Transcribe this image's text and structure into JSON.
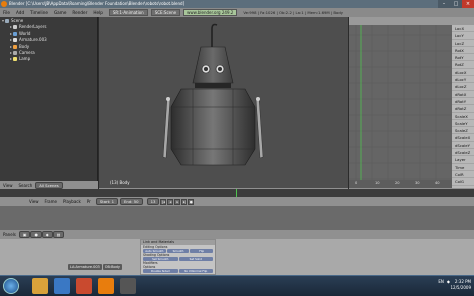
{
  "window": {
    "title": "Blender [C:\\Users\\JB\\AppData\\Roaming\\Blender Foundation\\Blender\\robots\\robot.blend]"
  },
  "menu": {
    "items": [
      "File",
      "Add",
      "Timeline",
      "Game",
      "Render",
      "Help"
    ],
    "screen": "SR:1-Animation",
    "scene": "SCE:Scene",
    "url": "www.blender.org 249.2",
    "stats": "Ve:998 | Fa:1026 | Ob:2-2 | La:1 | Mem:1.69M | Body"
  },
  "outliner": {
    "rows": [
      {
        "label": "Scene",
        "depth": 0,
        "expanded": true,
        "icon": "scene-icon"
      },
      {
        "label": "RenderLayers",
        "depth": 1,
        "expanded": false,
        "icon": "render-layers-icon"
      },
      {
        "label": "World",
        "depth": 1,
        "expanded": false,
        "icon": "world-icon"
      },
      {
        "label": "Armature.003",
        "depth": 1,
        "expanded": false,
        "icon": "armature-icon"
      },
      {
        "label": "Body",
        "depth": 1,
        "expanded": false,
        "icon": "mesh-icon"
      },
      {
        "label": "Camera",
        "depth": 1,
        "expanded": false,
        "icon": "camera-icon"
      },
      {
        "label": "Lamp",
        "depth": 1,
        "expanded": false,
        "icon": "lamp-icon"
      }
    ]
  },
  "outliner_toolbar": {
    "view": "View",
    "search": "Search",
    "scope": "All Scenes"
  },
  "viewport": {
    "status": "(13) Body",
    "menus": [
      "View",
      "Select",
      "Object"
    ],
    "mode": "Object Mode",
    "pivot": "Global"
  },
  "curve_editor": {
    "header": "",
    "menus": [
      "View",
      "Select",
      "Marker",
      "Curve",
      "Key"
    ],
    "mode": "Object",
    "ruler": [
      "0",
      "10",
      "20",
      "30",
      "40"
    ],
    "channels": [
      "LocX",
      "LocY",
      "LocZ",
      "RotX",
      "RotY",
      "RotZ",
      "dLocX",
      "dLocY",
      "dLocZ",
      "dRotX",
      "dRotY",
      "dRotZ",
      "ScaleX",
      "ScaleY",
      "ScaleZ",
      "dScaleX",
      "dScaleY",
      "dScaleZ",
      "Layer",
      "Time",
      "ColR",
      "ColG",
      "ColB"
    ]
  },
  "timeline": {
    "menus": [
      "View",
      "Frame",
      "Playback",
      "Pr"
    ],
    "start": "Start: 1",
    "end": "End: 50",
    "current": "13"
  },
  "buttons": {
    "label": "Panels",
    "context": [
      "LA:Armature.003",
      "OB:Body"
    ],
    "link_panel": {
      "title": "Link and Materials",
      "edit_options": "Editing Options",
      "shading": "Shading Options",
      "modifiers": "Modifiers",
      "options": "Options",
      "row1": [
        "Auto Smooth",
        "Smooth",
        "Flip"
      ],
      "row2": [
        "Set Smooth",
        "Set Solid"
      ],
      "row3": [
        "Double Sided",
        "No V.Normal Flip"
      ]
    }
  },
  "taskbar": {
    "time": "2:32 PM",
    "date": "12/5/2009",
    "tray": [
      "EN",
      "◆"
    ]
  }
}
